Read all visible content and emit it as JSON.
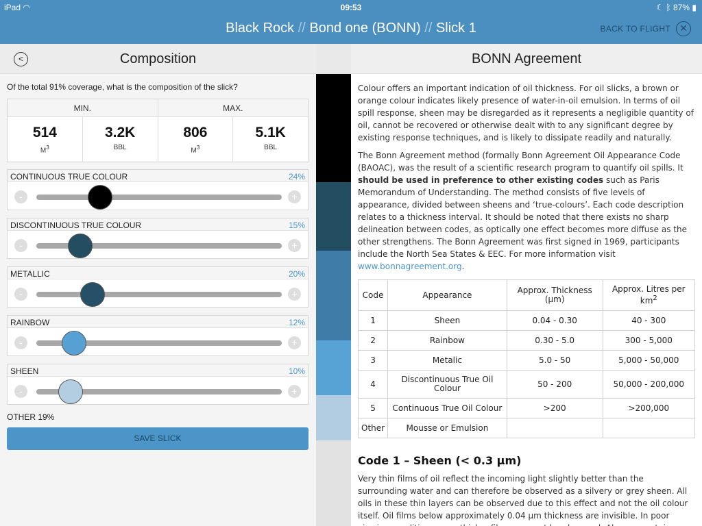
{
  "status": {
    "device": "iPad",
    "time": "09:53",
    "battery": "87%"
  },
  "header": {
    "crumb1": "Black Rock",
    "crumb2": "Bond one (BONN)",
    "crumb3": "Slick 1",
    "sep": "//",
    "back_to_flight": "BACK TO FLIGHT"
  },
  "left": {
    "title": "Composition",
    "question": "Of the total 91% coverage, what is the composition of the slick?",
    "min_label": "MIN.",
    "max_label": "MAX.",
    "cells": [
      {
        "value": "514",
        "unit": "M",
        "sup": "3"
      },
      {
        "value": "3.2K",
        "unit": "BBL",
        "sup": ""
      },
      {
        "value": "806",
        "unit": "M",
        "sup": "3"
      },
      {
        "value": "5.1K",
        "unit": "BBL",
        "sup": ""
      }
    ],
    "sliders": [
      {
        "label": "CONTINUOUS TRUE COLOUR",
        "pct": "24%",
        "level": 0.26,
        "color": "#000000"
      },
      {
        "label": "DISCONTINUOUS TRUE COLOUR",
        "pct": "15%",
        "level": 0.18,
        "color": "#234e61"
      },
      {
        "label": "METALLIC",
        "pct": "20%",
        "level": 0.23,
        "color": "#255068"
      },
      {
        "label": "RAINBOW",
        "pct": "12%",
        "level": 0.155,
        "color": "#56a0d4"
      },
      {
        "label": "SHEEN",
        "pct": "10%",
        "level": 0.14,
        "color": "#b3cee0"
      }
    ],
    "minus": "-",
    "plus": "+",
    "other": "OTHER 19%",
    "save": "SAVE SLICK"
  },
  "strip_colors": [
    "#000000",
    "#234e61",
    "#3f7ca8",
    "#57a3d6",
    "#b2cde2",
    "#e2e2e2"
  ],
  "right": {
    "title": "BONN Agreement",
    "p1": "Colour offers an important indication of oil thickness. For oil slicks, a brown or orange colour indicates likely presence of water-in-oil emulsion. In terms of oil spill response, sheen may be disregarded as it represents a negligible quantity of oil, cannot be recovered or otherwise dealt with to any significant degree by existing response techniques, and is likely to dissipate readily and naturally.",
    "p2a": "The Bonn Agreement method (formally Bonn Agreement Oil Appearance Code (BAOAC), was the result of a scientific research program to quantify oil spills. It ",
    "p2b": "should be used in preference to other existing codes",
    "p2c": " such as Paris Memorandum of Understanding. The method consists of five levels of appearance, divided between sheens and ‘true-colours’. Each code description relates to a thickness interval. It should be noted that there exists no sharp delineation between codes, as optically one effect becomes more diffuse as the other strengthens. The Bonn Agreement was first signed in 1969, participants include the North Sea States & EEC. For more information visit ",
    "link": "www.bonnagreement.org",
    "p2d": ".",
    "table_head": {
      "code": "Code",
      "appearance": "Appearance",
      "thickness": "Approx. Thickness (µm)",
      "litres": "Approx. Litres per km",
      "litres_sup": "2"
    },
    "rows": [
      {
        "code": "1",
        "appearance": "Sheen",
        "thickness": "0.04 - 0.30",
        "litres": "40 - 300"
      },
      {
        "code": "2",
        "appearance": "Rainbow",
        "thickness": "0.30 - 5.0",
        "litres": "300 - 5,000"
      },
      {
        "code": "3",
        "appearance": "Metalic",
        "thickness": "5.0 - 50",
        "litres": "5,000 - 50,000"
      },
      {
        "code": "4",
        "appearance": "Discontinuous True Oil Colour",
        "thickness": "50 - 200",
        "litres": "50,000 - 200,000"
      },
      {
        "code": "5",
        "appearance": "Continuous True Oil Colour",
        "thickness": ">200",
        "litres": ">200,000"
      },
      {
        "code": "Other",
        "appearance": "Mousse or Emulsion",
        "thickness": "",
        "litres": ""
      }
    ],
    "code1_heading": "Code 1 – Sheen (< 0.3 µm)",
    "code1_text": "Very thin films of oil reflect the incoming light slightly better than the surrounding water and can therefore be observed as a silvery or grey sheen. All oils in these thin layers can be observed due to this effect and not the oil colour itself. Oil films below approximately 0.04 µm thickness are invisible. In poor viewing conditions even thicker films may not be observed. Above a certain height or angle of view the observed film may disappear."
  }
}
